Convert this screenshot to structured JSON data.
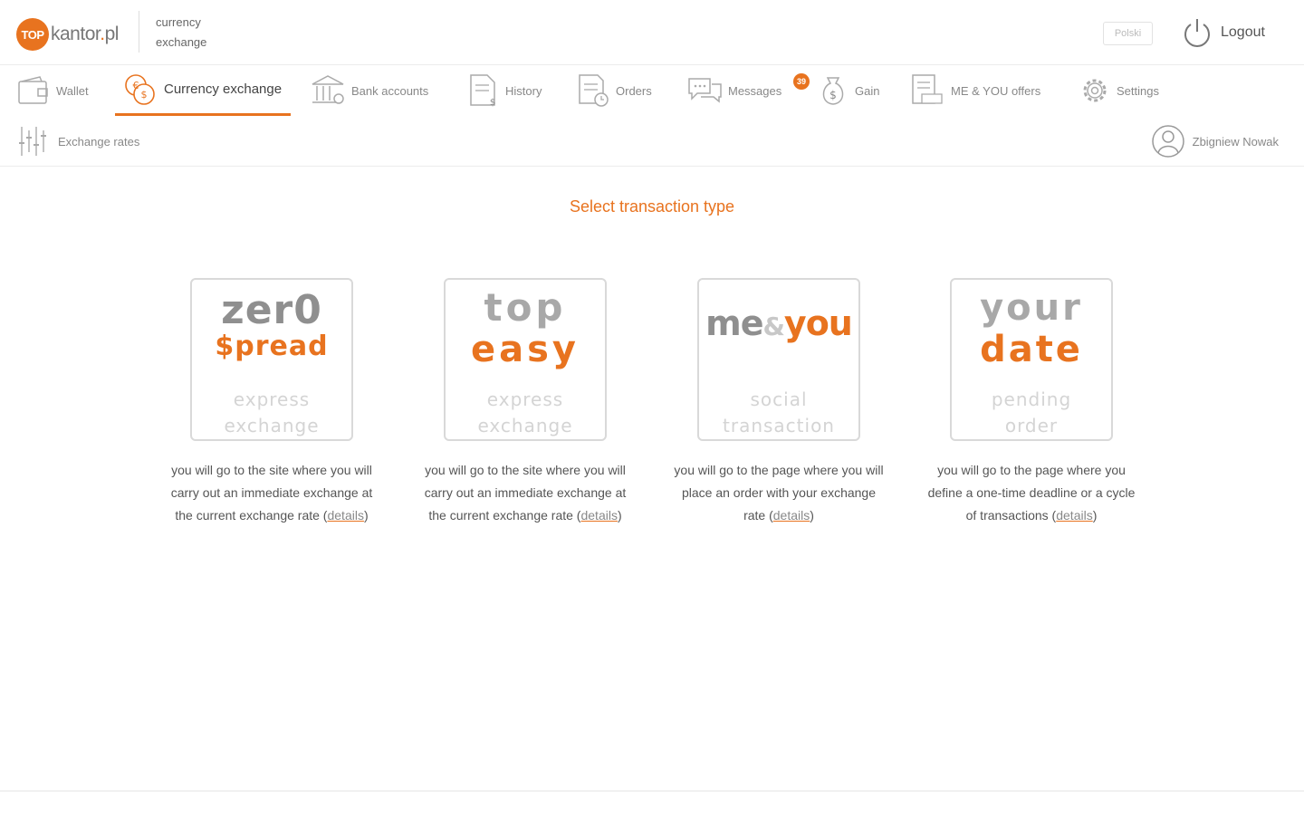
{
  "header": {
    "logo": {
      "badge": "TOP",
      "name": "kantor",
      "dot": ".",
      "tld": "pl"
    },
    "subtitle": [
      "currency",
      "exchange"
    ],
    "language_button": "Polski",
    "logout_label": "Logout"
  },
  "nav": {
    "items": [
      {
        "label": "Wallet",
        "icon": "wallet-icon"
      },
      {
        "label": "Currency exchange",
        "icon": "currency-exchange-icon",
        "active": true
      },
      {
        "label": "Bank accounts",
        "icon": "bank-icon"
      },
      {
        "label": "History",
        "icon": "history-document-icon"
      },
      {
        "label": "Orders",
        "icon": "orders-clock-icon"
      },
      {
        "label": "Messages",
        "icon": "messages-icon",
        "badge": "39"
      },
      {
        "label": "Gain",
        "icon": "money-bag-icon"
      },
      {
        "label": "ME & YOU offers",
        "icon": "offers-icon"
      },
      {
        "label": "Settings",
        "icon": "gear-icon"
      }
    ],
    "row2": {
      "label": "Exchange rates",
      "icon": "exchange-rates-icon"
    },
    "user": {
      "name": "Zbigniew Nowak",
      "icon": "user-avatar-icon"
    }
  },
  "main": {
    "title": "Select transaction type",
    "cards": [
      {
        "logo_line1": "zer0",
        "logo_line2": "$pread",
        "sub_line1": "express",
        "sub_line2": "exchange",
        "description": "you will go to the site where you will carry out an immediate exchange at the current exchange rate",
        "link": "details"
      },
      {
        "logo_line1": "top",
        "logo_line2": "easy",
        "sub_line1": "express",
        "sub_line2": "exchange",
        "description": "you will go to the site where you will carry out an immediate exchange at the current exchange rate",
        "link": "details"
      },
      {
        "logo_part1": "me",
        "logo_amp": "&",
        "logo_part2": "you",
        "sub_line1": "social",
        "sub_line2": "transaction",
        "description": "you will go to the page where you will place an order with your exchange rate",
        "link": "details"
      },
      {
        "logo_line1": "your",
        "logo_line2": "date",
        "sub_line1": "pending",
        "sub_line2": "order",
        "description": "you will go to the page where you define a one-time deadline or a cycle of transactions",
        "link": "details"
      }
    ]
  },
  "colors": {
    "accent": "#e8731f",
    "text": "#555555",
    "muted": "#d4d4d4"
  }
}
